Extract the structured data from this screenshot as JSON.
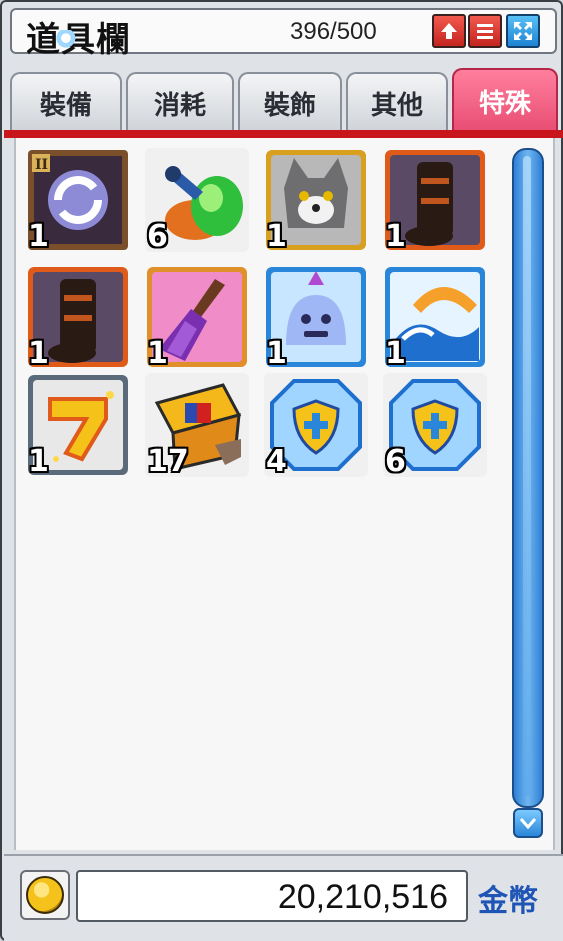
{
  "window": {
    "title": "道具欄",
    "capacity": "396/500",
    "buttons": {
      "up": "🠉",
      "list": "☰",
      "expand": "⛶"
    }
  },
  "tabs": [
    {
      "label": "裝備",
      "active": false
    },
    {
      "label": "消耗",
      "active": false
    },
    {
      "label": "裝飾",
      "active": false
    },
    {
      "label": "其他",
      "active": false
    },
    {
      "label": "特殊",
      "active": true
    }
  ],
  "items": [
    {
      "icon": "rotate-scroll-icon",
      "qty": "1"
    },
    {
      "icon": "green-potion-icon",
      "qty": "6"
    },
    {
      "icon": "wolf-pet-icon",
      "qty": "1"
    },
    {
      "icon": "dark-armor-icon",
      "qty": "1"
    },
    {
      "icon": "dark-armor-icon",
      "qty": "1"
    },
    {
      "icon": "purple-broom-icon",
      "qty": "1"
    },
    {
      "icon": "ghost-slime-icon",
      "qty": "1"
    },
    {
      "icon": "wave-scroll-icon",
      "qty": "1"
    },
    {
      "icon": "golden-heart-icon",
      "qty": "1"
    },
    {
      "icon": "gift-box-icon",
      "qty": "17"
    },
    {
      "icon": "shield-crystal-icon",
      "qty": "4"
    },
    {
      "icon": "shield-crystal-icon",
      "qty": "6"
    }
  ],
  "footer": {
    "money": "20,210,516",
    "currency_label": "金幣"
  },
  "colors": {
    "active_tab": "#e84d72",
    "tab_underline": "#c9161d",
    "scrollbar": "#2f7fd6",
    "currency_text": "#1f55b4"
  }
}
